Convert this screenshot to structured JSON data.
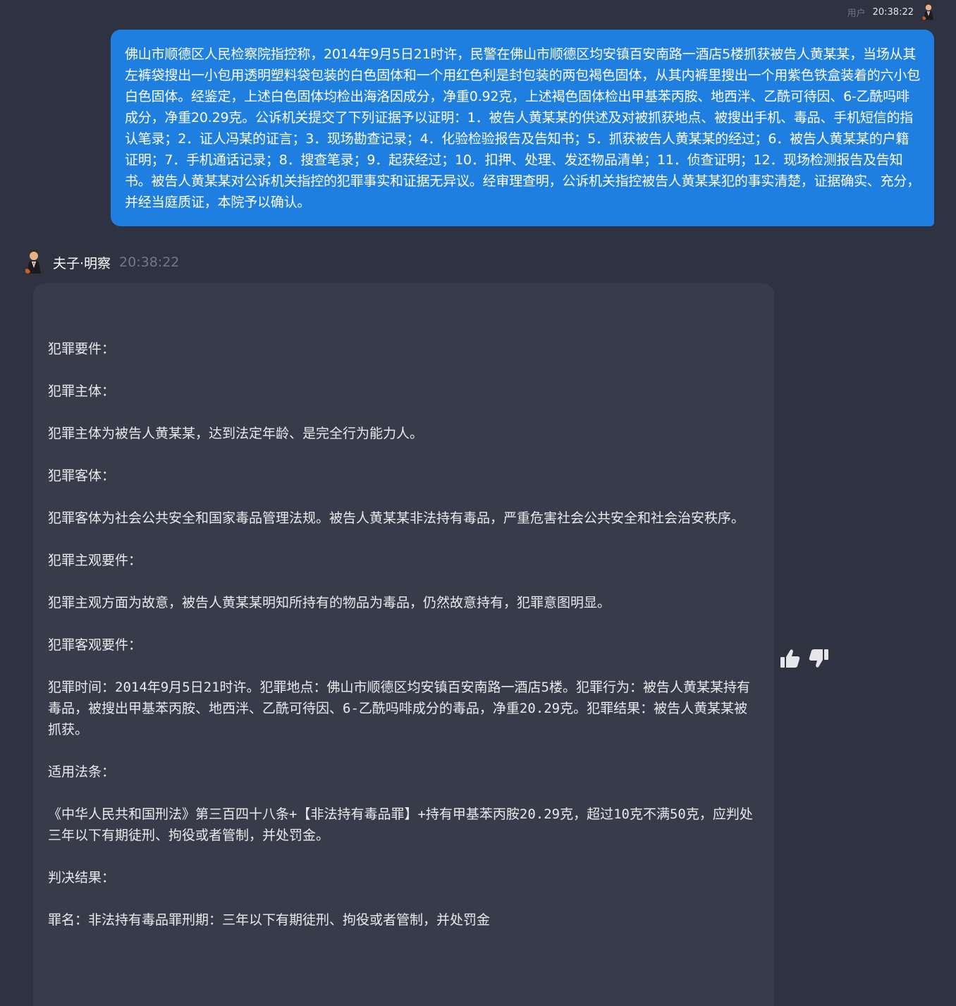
{
  "user_message": {
    "role_label": "用户",
    "time": "20:38:22",
    "text": "佛山市顺德区人民检察院指控称，2014年9月5日21时许，民警在佛山市顺德区均安镇百安南路一酒店5楼抓获被告人黄某某，当场从其左裤袋搜出一小包用透明塑料袋包装的白色固体和一个用红色利是封包装的两包褐色固体，从其内裤里搜出一个用紫色铁盒装着的六小包白色固体。经鉴定，上述白色固体均检出海洛因成分，净重0.92克，上述褐色固体检出甲基苯丙胺、地西泮、乙酰可待因、6-乙酰吗啡成分，净重20.29克。公诉机关提交了下列证据予以证明：1．被告人黄某某的供述及对被抓获地点、被搜出手机、毒品、手机短信的指认笔录；2．证人冯某的证言；3．现场勘查记录；4．化验检验报告及告知书；5．抓获被告人黄某某的经过；6．被告人黄某某的户籍证明；7．手机通话记录；8．搜查笔录；9．起获经过；10．扣押、处理、发还物品清单；11．侦查证明；12．现场检测报告及告知书。被告人黄某某对公诉机关指控的犯罪事实和证据无异议。经审理查明，公诉机关指控被告人黄某某犯的事实清楚，证据确实、充分，并经当庭质证，本院予以确认。",
    "avatar_icon": "user-avatar-icon"
  },
  "bot_message": {
    "name": "夫子·明察",
    "time": "20:38:22",
    "avatar_icon": "bot-avatar-icon",
    "paragraphs": [
      "犯罪要件：",
      "犯罪主体：",
      "犯罪主体为被告人黄某某，达到法定年龄、是完全行为能力人。",
      "犯罪客体：",
      "犯罪客体为社会公共安全和国家毒品管理法规。被告人黄某某非法持有毒品，严重危害社会公共安全和社会治安秩序。",
      "犯罪主观要件：",
      "犯罪主观方面为故意，被告人黄某某明知所持有的物品为毒品，仍然故意持有，犯罪意图明显。",
      "犯罪客观要件：",
      "犯罪时间：2014年9月5日21时许。犯罪地点：佛山市顺德区均安镇百安南路一酒店5楼。犯罪行为：被告人黄某某持有毒品，被搜出甲基苯丙胺、地西泮、乙酰可待因、6-乙酰吗啡成分的毒品，净重20.29克。犯罪结果：被告人黄某某被抓获。",
      "适用法条：",
      "《中华人民共和国刑法》第三百四十八条+【非法持有毒品罪】+持有甲基苯丙胺20.29克，超过10克不满50克，应判处三年以下有期徒刑、拘役或者管制，并处罚金。",
      "判决结果：",
      "罪名：非法持有毒品罪刑期：三年以下有期徒刑、拘役或者管制，并处罚金"
    ]
  },
  "feedback": {
    "like_icon": "thumbs-up-icon",
    "dislike_icon": "thumbs-down-icon"
  },
  "colors": {
    "background": "#2f3240",
    "user_bubble": "#1f7fe0",
    "bot_bubble": "#383b4a"
  }
}
